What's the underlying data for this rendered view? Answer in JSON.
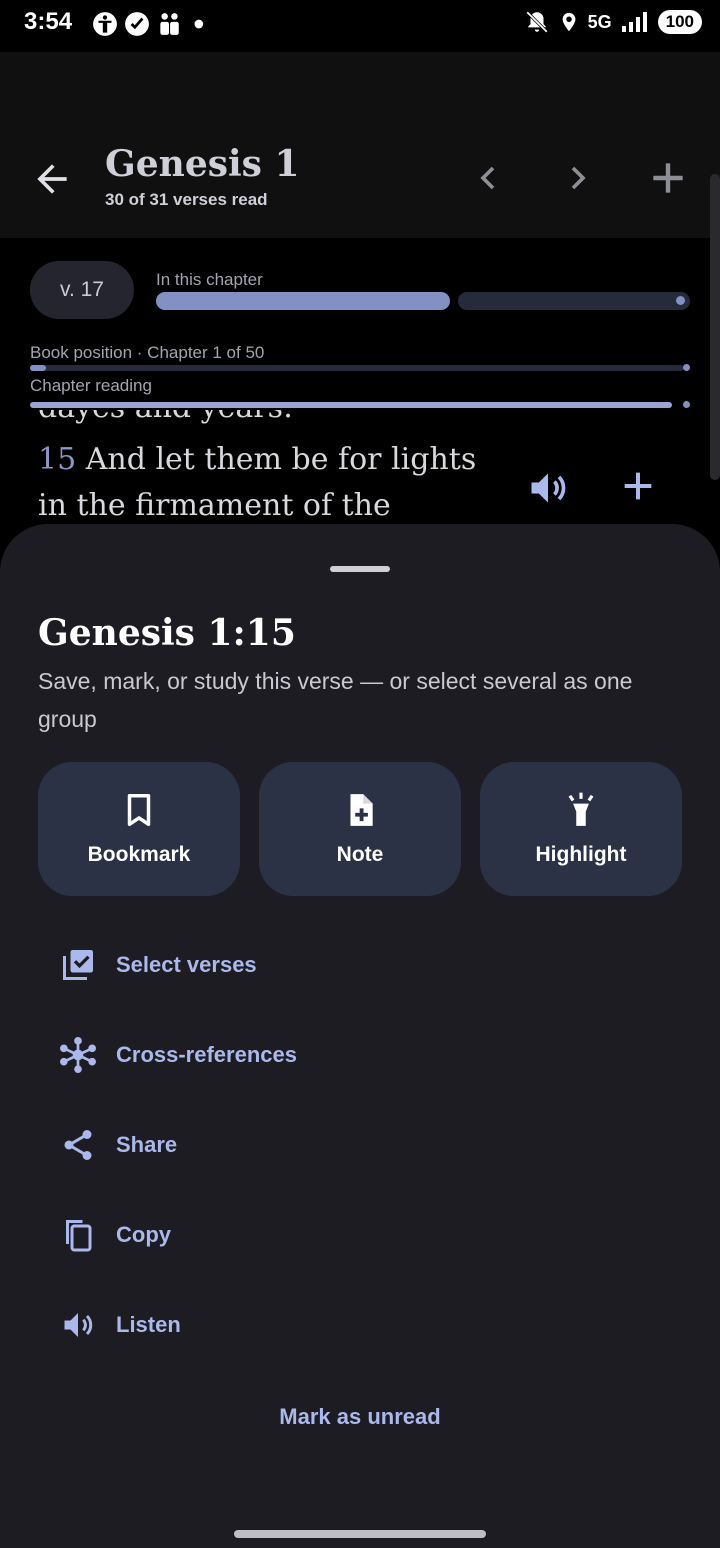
{
  "status_bar": {
    "time": "3:54",
    "network": "5G",
    "battery": "100",
    "icons": [
      "accessibility-icon",
      "verified-icon",
      "people-icon",
      "dot-icon",
      "mute-icon",
      "location-icon",
      "signal-icon"
    ]
  },
  "app_bar": {
    "title": "Genesis 1",
    "subtitle": "30 of 31 verses read",
    "icons": [
      "back-arrow-icon",
      "chevron-left-icon",
      "chevron-right-icon",
      "plus-icon"
    ]
  },
  "progress": {
    "verse_pill": "v. 17",
    "in_chapter_label": "In this chapter",
    "in_chapter_fraction": 0.56,
    "book_position_label": "Book position · Chapter 1 of 50",
    "book_position_fraction": 0.02,
    "chapter_reading_label": "Chapter reading",
    "chapter_reading_fraction": 0.97
  },
  "reader": {
    "previous_line": "dayes and years:",
    "verse_number": "15",
    "verse_text": "And let them be for lights in the firmament of the heaven,"
  },
  "sheet": {
    "title": "Genesis 1:15",
    "description": "Save, mark, or study this verse — or select several as one group",
    "actions": [
      {
        "label": "Bookmark",
        "icon": "bookmark-icon"
      },
      {
        "label": "Note",
        "icon": "note-add-icon"
      },
      {
        "label": "Highlight",
        "icon": "flashlight-icon"
      }
    ],
    "items": [
      {
        "label": "Select verses",
        "icon": "select-check-icon"
      },
      {
        "label": "Cross-references",
        "icon": "network-icon"
      },
      {
        "label": "Share",
        "icon": "share-icon"
      },
      {
        "label": "Copy",
        "icon": "copy-icon"
      },
      {
        "label": "Listen",
        "icon": "speaker-icon"
      }
    ],
    "mark_unread": "Mark as unread"
  },
  "colors": {
    "accent": "#aab8ec",
    "progress": "#8290c4",
    "card": "#2c3245",
    "sheet": "#1d1c22"
  }
}
